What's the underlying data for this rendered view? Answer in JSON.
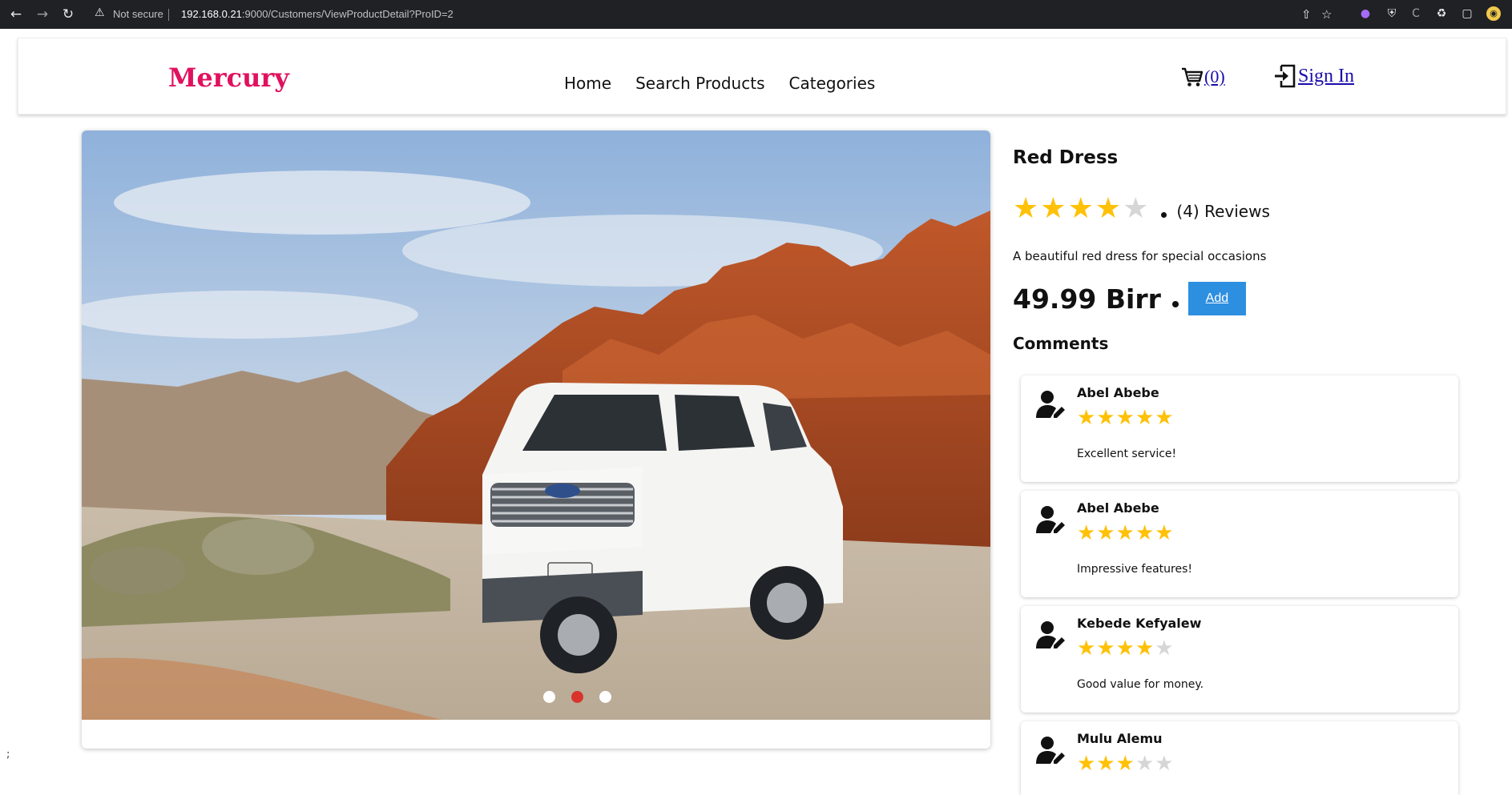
{
  "browser": {
    "security_label": "Not secure",
    "url_host": "192.168.0.21",
    "url_path": ":9000/Customers/ViewProductDetail?ProID=2"
  },
  "header": {
    "logo": "Mercury",
    "nav": [
      "Home",
      "Search Products",
      "Categories"
    ],
    "cart_count": "(0)",
    "signin": "Sign In"
  },
  "carousel": {
    "slide_count": 3,
    "active_index": 1,
    "colors": {
      "active_dot": "#d9342b",
      "inactive_dot": "#ffffff"
    }
  },
  "product": {
    "name": "Red Dress",
    "rating": 4,
    "rating_max": 5,
    "reviews": "(4) Reviews",
    "description": "A beautiful red dress for special occasions",
    "price": "49.99 Birr",
    "add_label": "Add"
  },
  "comments_title": "Comments",
  "comments": [
    {
      "author": "Abel Abebe",
      "rating": 5,
      "text": "Excellent service!"
    },
    {
      "author": "Abel Abebe",
      "rating": 5,
      "text": "Impressive features!"
    },
    {
      "author": "Kebede Kefyalew",
      "rating": 4,
      "text": "Good value for money."
    },
    {
      "author": "Mulu Alemu",
      "rating": 3,
      "text": ""
    }
  ],
  "stray_text": ";",
  "colors": {
    "brand": "#e0115f",
    "accent": "#2d8fe0",
    "star": "#ffc107",
    "star_empty": "#d6d6d6"
  }
}
